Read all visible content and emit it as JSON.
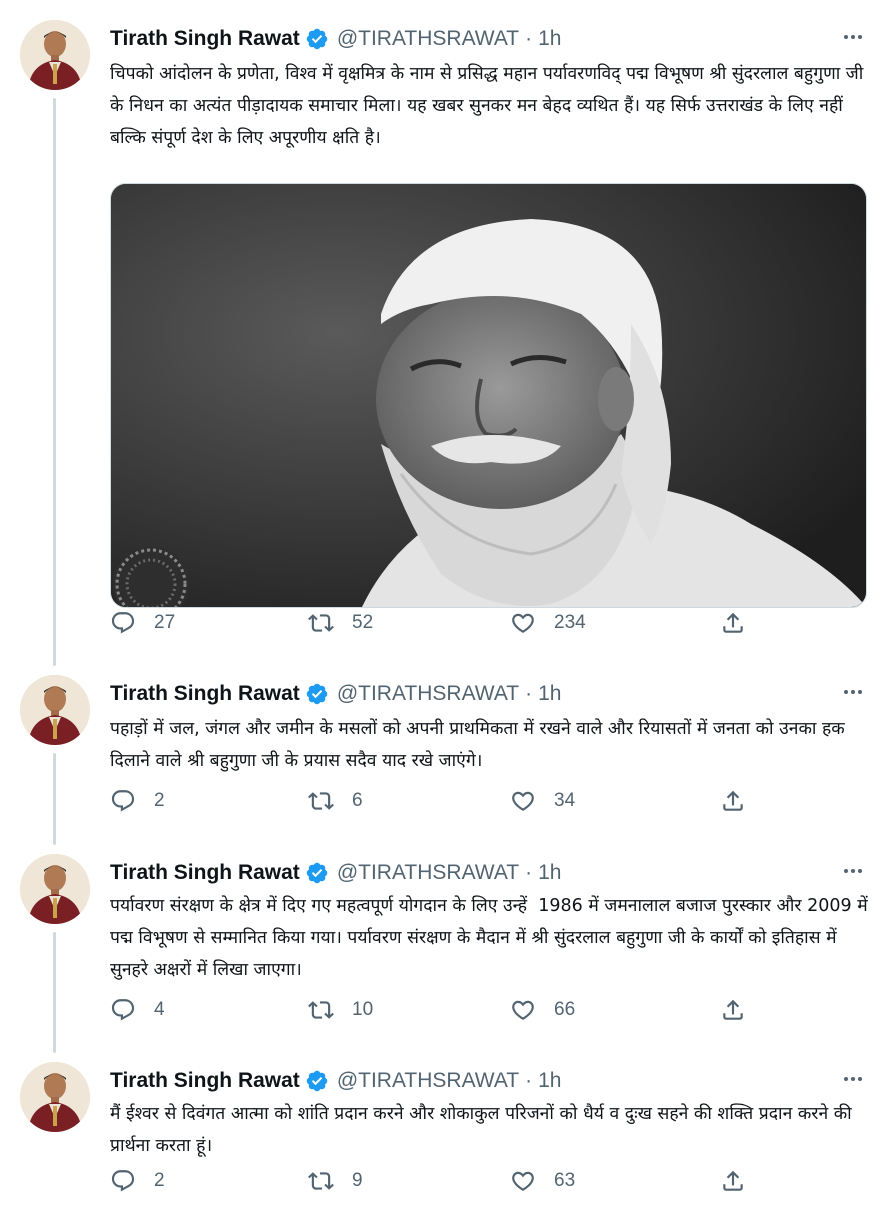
{
  "author": {
    "name": "Tirath Singh Rawat",
    "handle": "@TIRATHSRAWAT",
    "time": "1h",
    "verified": true
  },
  "tweets": [
    {
      "text": "चिपको आंदोलन के प्रणेता, विश्व में वृक्षमित्र के नाम से प्रसिद्ध महान पर्यावरणविद् पद्म विभूषण श्री सुंदरलाल बहुगुणा जी के निधन का अत्यंत पीड़ादायक समाचार मिला। यह खबर सुनकर मन बेहद व्यथित हैं। यह सिर्फ उत्तराखंड के लिए नहीं बल्कि संपूर्ण देश के लिए अपूरणीय क्षति है।",
      "replies": "27",
      "retweets": "52",
      "likes": "234",
      "has_media": true
    },
    {
      "text": "पहाड़ों में जल, जंगल और जमीन के मसलों को अपनी प्राथमिकता में रखने वाले और रियासतों में जनता को उनका हक दिलाने वाले श्री बहुगुणा जी के प्रयास सदैव याद रखे जाएंगे।",
      "replies": "2",
      "retweets": "6",
      "likes": "34",
      "has_media": false
    },
    {
      "text": "पर्यावरण संरक्षण के क्षेत्र में दिए गए महत्वपूर्ण योगदान के लिए उन्हें  1986 में जमनालाल बजाज पुरस्कार और 2009 में पद्म विभूषण से सम्मानित किया गया। पर्यावरण संरक्षण के मैदान में श्री सुंदरलाल बहुगुणा जी के कार्यों को इतिहास में सुनहरे अक्षरों में लिखा जाएगा।",
      "replies": "4",
      "retweets": "10",
      "likes": "66",
      "has_media": false
    },
    {
      "text": "मैं ईश्वर से दिवंगत आत्मा को शांति प्रदान करने और शोकाकुल परिजनों को धैर्य व दुःख सहने की शक्ति प्रदान करने की प्रार्थना करता हूं।",
      "replies": "2",
      "retweets": "9",
      "likes": "63",
      "has_media": false
    }
  ],
  "icons": {
    "reply": "reply-icon",
    "retweet": "retweet-icon",
    "like": "heart-icon",
    "share": "share-icon",
    "more": "more-icon",
    "verified": "verified-badge-icon"
  },
  "colors": {
    "verified_blue": "#1d9bf0",
    "secondary_text": "#536471",
    "thread_line": "#cfd9de"
  }
}
